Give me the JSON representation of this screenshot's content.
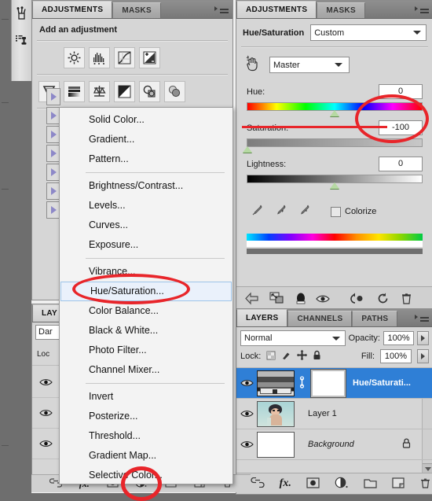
{
  "toolstrip": {
    "tools": [
      {
        "name": "brush-tools-icon",
        "label": "Tools"
      },
      {
        "name": "clone-stamp-icon",
        "label": "Clone Stamp"
      }
    ]
  },
  "adjustments_panel": {
    "tabs": [
      {
        "label": "ADJUSTMENTS",
        "active": true
      },
      {
        "label": "MASKS",
        "active": false
      }
    ],
    "heading": "Add an adjustment",
    "icons_row1": [
      "brightness-contrast-icon",
      "levels-icon",
      "curves-icon",
      "exposure-icon"
    ],
    "icons_row2": [
      "vibrance-icon",
      "hue-saturation-icon",
      "color-balance-icon",
      "black-white-icon",
      "photo-filter-icon",
      "channel-mixer-icon"
    ],
    "preset_arrows": 7
  },
  "hue_saturation_panel": {
    "tabs": [
      {
        "label": "ADJUSTMENTS",
        "active": true
      },
      {
        "label": "MASKS",
        "active": false
      }
    ],
    "title": "Hue/Saturation",
    "preset": "Custom",
    "targeted_adjust_icon": "hand-target-icon",
    "channel": "Master",
    "sliders": [
      {
        "label": "Hue:",
        "value": "0",
        "thumb_pct": 50
      },
      {
        "label": "Saturation:",
        "value": "-100",
        "thumb_pct": 0
      },
      {
        "label": "Lightness:",
        "value": "0",
        "thumb_pct": 50
      }
    ],
    "eyedroppers": [
      "eyedropper-icon",
      "eyedropper-plus-icon",
      "eyedropper-minus-icon"
    ],
    "colorize_label": "Colorize",
    "colorize_checked": false,
    "footer_icons": [
      "clip-to-layer-icon",
      "expand-view-icon",
      "mask-preview-icon",
      "toggle-visibility-icon",
      "previous-state-icon",
      "reset-icon",
      "delete-icon"
    ]
  },
  "menu": {
    "groups": [
      {
        "items": [
          {
            "label": "Solid Color...",
            "selected": false
          },
          {
            "label": "Gradient...",
            "selected": false
          },
          {
            "label": "Pattern...",
            "selected": false
          }
        ]
      },
      {
        "items": [
          {
            "label": "Brightness/Contrast...",
            "selected": false
          },
          {
            "label": "Levels...",
            "selected": false
          },
          {
            "label": "Curves...",
            "selected": false
          },
          {
            "label": "Exposure...",
            "selected": false
          }
        ]
      },
      {
        "items": [
          {
            "label": "Vibrance...",
            "selected": false
          },
          {
            "label": "Hue/Saturation...",
            "selected": true
          },
          {
            "label": "Color Balance...",
            "selected": false
          },
          {
            "label": "Black & White...",
            "selected": false
          },
          {
            "label": "Photo Filter...",
            "selected": false
          },
          {
            "label": "Channel Mixer...",
            "selected": false
          }
        ]
      },
      {
        "items": [
          {
            "label": "Invert",
            "selected": false
          },
          {
            "label": "Posterize...",
            "selected": false
          },
          {
            "label": "Threshold...",
            "selected": false
          },
          {
            "label": "Gradient Map...",
            "selected": false
          },
          {
            "label": "Selective Color...",
            "selected": false
          }
        ]
      }
    ]
  },
  "layers_hidden": {
    "tab": "LAY",
    "blend_mode": "Dar",
    "lock_label": "Loc"
  },
  "layers_panel": {
    "tabs": [
      {
        "label": "LAYERS",
        "active": true
      },
      {
        "label": "CHANNELS",
        "active": false
      },
      {
        "label": "PATHS",
        "active": false
      }
    ],
    "blend_mode": "Normal",
    "opacity_label": "Opacity:",
    "opacity_value": "100%",
    "lock_label": "Lock:",
    "lock_icons": [
      "lock-transparency-icon",
      "lock-pixels-icon",
      "lock-position-icon",
      "lock-all-icon"
    ],
    "fill_label": "Fill:",
    "fill_value": "100%",
    "rows": [
      {
        "name": "Hue/Saturati...",
        "kind": "adjustment",
        "selected": true,
        "visible": true,
        "locked": false
      },
      {
        "name": "Layer 1",
        "kind": "image",
        "selected": false,
        "visible": true,
        "locked": false
      },
      {
        "name": "Background",
        "kind": "background",
        "selected": false,
        "visible": true,
        "locked": true
      }
    ],
    "footer_icons": [
      "link-layers-icon",
      "layer-style-fx-icon",
      "add-mask-icon",
      "new-adjustment-layer-icon",
      "new-group-icon",
      "new-layer-icon",
      "delete-layer-icon"
    ]
  },
  "annotations": {
    "color": "#e8252a",
    "marks": [
      {
        "name": "saturation-value-highlight",
        "target": "-100"
      },
      {
        "name": "hue-saturation-menu-highlight",
        "target": "Hue/Saturation..."
      },
      {
        "name": "new-adjustment-layer-highlight",
        "target": "new-adjustment-layer-icon"
      }
    ]
  }
}
